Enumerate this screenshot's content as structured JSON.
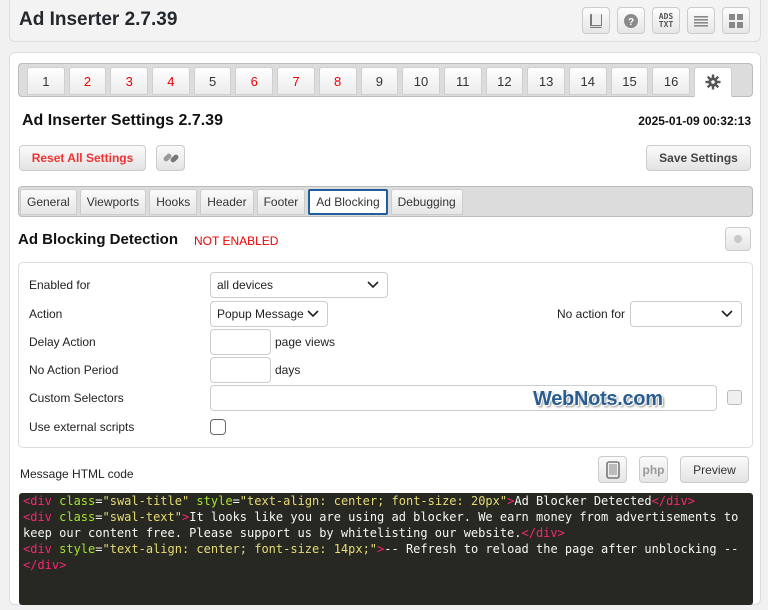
{
  "header": {
    "title": "Ad Inserter 2.7.39",
    "icons": [
      "book-icon",
      "help-icon",
      "ads-txt-icon",
      "list-icon",
      "grid-icon"
    ],
    "ads_txt_lines": [
      "ADS",
      "TXT"
    ]
  },
  "block_tabs": {
    "items": [
      "1",
      "2",
      "3",
      "4",
      "5",
      "6",
      "7",
      "8",
      "9",
      "10",
      "11",
      "12",
      "13",
      "14",
      "15",
      "16"
    ],
    "red_items": [
      "2",
      "3",
      "4",
      "6",
      "7",
      "8"
    ],
    "settings_icon": "gear-icon"
  },
  "settings": {
    "title": "Ad Inserter Settings 2.7.39",
    "timestamp": "2025-01-09 00:32:13",
    "reset_label": "Reset All Settings",
    "save_label": "Save Settings"
  },
  "sub_tabs": {
    "items": [
      "General",
      "Viewports",
      "Hooks",
      "Header",
      "Footer",
      "Ad Blocking",
      "Debugging"
    ],
    "active": "Ad Blocking"
  },
  "ad_blocking": {
    "title": "Ad Blocking Detection",
    "status": "NOT ENABLED",
    "enabled_for": {
      "label": "Enabled for",
      "value": "all devices"
    },
    "action": {
      "label": "Action",
      "value": "Popup Message"
    },
    "no_action_for": {
      "label": "No action for",
      "value": ""
    },
    "delay_action": {
      "label": "Delay Action",
      "value": "",
      "unit": "page views"
    },
    "no_action_period": {
      "label": "No Action Period",
      "value": "",
      "unit": "days"
    },
    "custom_selectors": {
      "label": "Custom Selectors",
      "value": ""
    },
    "use_external_scripts": {
      "label": "Use external scripts",
      "checked": false
    }
  },
  "watermark": "WebNots.com",
  "message": {
    "label": "Message HTML code",
    "php_label": "php",
    "preview_label": "Preview",
    "code": {
      "l1_tag_open": "<div",
      "l1_attr1": " class",
      "l1_eq1": "=",
      "l1_val1": "\"swal-title\"",
      "l1_attr2": " style",
      "l1_eq2": "=",
      "l1_val2": "\"text-align: center; font-size: 20px\"",
      "l1_close": ">",
      "l1_text": "Ad Blocker Detected",
      "l1_end": "</div>",
      "l2_tag_open": "<div",
      "l2_attr1": " class",
      "l2_eq1": "=",
      "l2_val1": "\"swal-text\"",
      "l2_close": ">",
      "l2_text": "It looks like you are using ad blocker. We earn money from advertisements to keep our content free. Please support us by whitelisting our website.",
      "l2_end": "</div>",
      "l3_tag_open": "<div",
      "l3_attr1": " style",
      "l3_eq1": "=",
      "l3_val1": "\"text-align: center; font-size: 14px;\"",
      "l3_close": ">",
      "l3_text": "-- Refresh to reload the page after unblocking --",
      "l3_end": "</div>"
    }
  }
}
